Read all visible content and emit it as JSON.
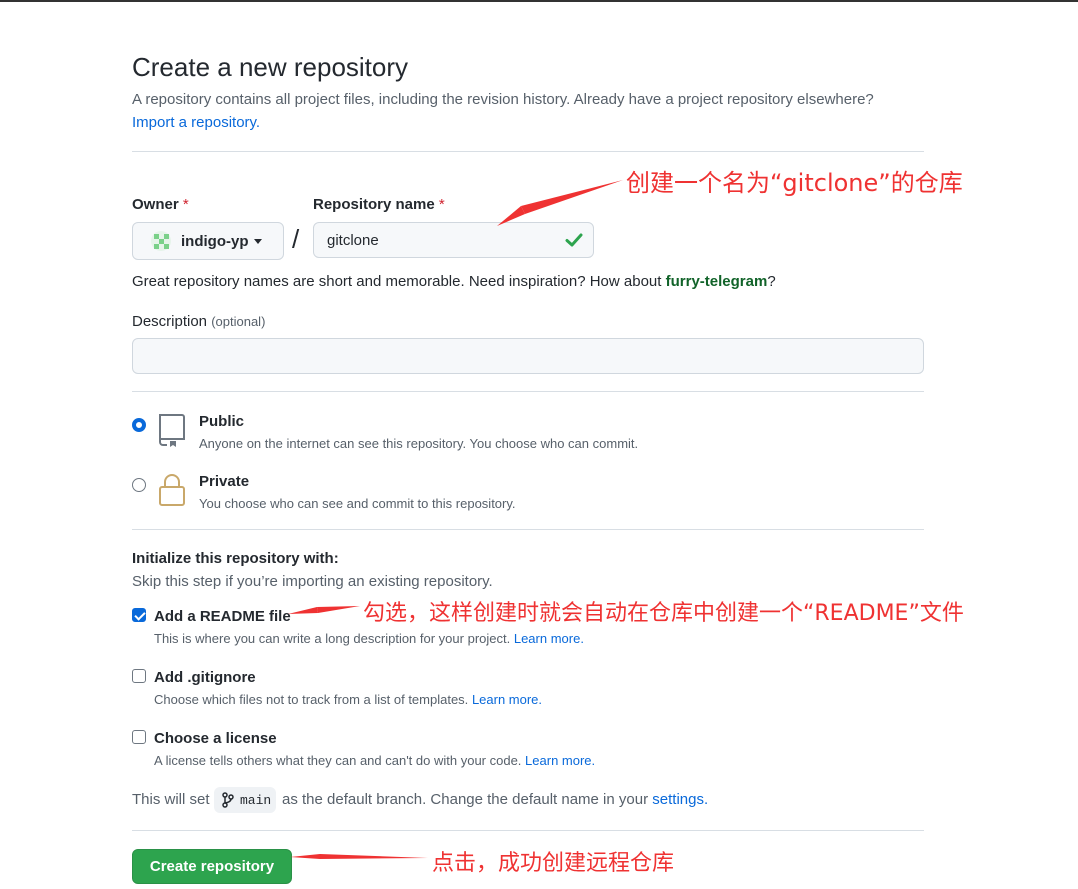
{
  "header": {
    "title": "Create a new repository",
    "subtitle": "A repository contains all project files, including the revision history. Already have a project repository elsewhere?",
    "import_link": "Import a repository."
  },
  "owner": {
    "label": "Owner",
    "required_mark": "*",
    "value": "indigo-yp"
  },
  "separator": "/",
  "repo_name": {
    "label": "Repository name",
    "required_mark": "*",
    "value": "gitclone"
  },
  "hint": {
    "prefix": "Great repository names are short and memorable. Need inspiration? How about ",
    "suggestion": "furry-telegram",
    "suffix": "?"
  },
  "description": {
    "label": "Description",
    "optional": "(optional)",
    "value": ""
  },
  "visibility": {
    "public": {
      "title": "Public",
      "desc": "Anyone on the internet can see this repository. You choose who can commit.",
      "selected": true
    },
    "private": {
      "title": "Private",
      "desc": "You choose who can see and commit to this repository.",
      "selected": false
    }
  },
  "init": {
    "title": "Initialize this repository with:",
    "subtitle": "Skip this step if you’re importing an existing repository.",
    "readme": {
      "title": "Add a README file",
      "desc": "This is where you can write a long description for your project.",
      "learn": "Learn more.",
      "checked": true
    },
    "gitignore": {
      "title": "Add .gitignore",
      "desc": "Choose which files not to track from a list of templates.",
      "learn": "Learn more.",
      "checked": false
    },
    "license": {
      "title": "Choose a license",
      "desc": "A license tells others what they can and can't do with your code.",
      "learn": "Learn more.",
      "checked": false
    }
  },
  "branch": {
    "prefix": "This will set",
    "name": "main",
    "middle": "as the default branch. Change the default name in your",
    "settings_link": "settings."
  },
  "submit": {
    "label": "Create repository"
  },
  "annotations": {
    "repo_name_note": "创建一个名为“gitclone”的仓库",
    "readme_note": "勾选，这样创建时就会自动在仓库中创建一个“README”文件",
    "create_note": "点击，成功创建远程仓库",
    "color": "#ef3232"
  },
  "colors": {
    "primary_button": "#2da44e",
    "link": "#0969da",
    "check_ok": "#2da44e"
  }
}
